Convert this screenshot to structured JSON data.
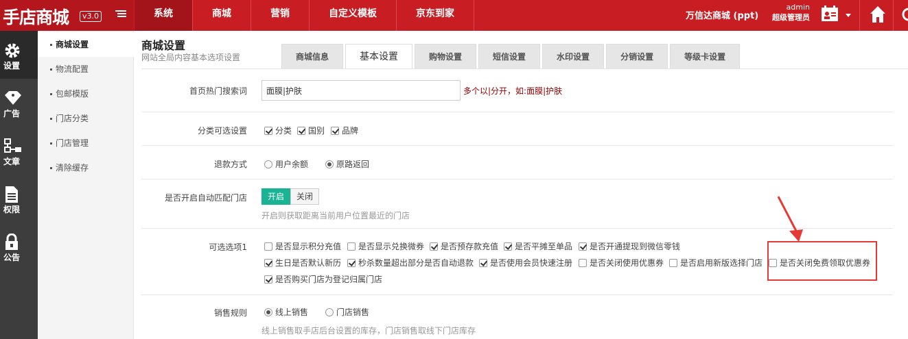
{
  "topbar": {
    "logo": "手店商城",
    "version": "v3.0",
    "nav": [
      "系统",
      "商城",
      "营销",
      "自定义模板",
      "京东到家"
    ],
    "shop_name": "万信达商城 (ppt)",
    "user": "admin",
    "role": "超级管理员"
  },
  "iconbar": {
    "items": [
      {
        "label": "设置",
        "icon": "gear-icon"
      },
      {
        "label": "广告",
        "icon": "tag-icon"
      },
      {
        "label": "文章",
        "icon": "sitemap-icon"
      },
      {
        "label": "权限",
        "icon": "document-icon"
      },
      {
        "label": "公告",
        "icon": "lock-icon"
      }
    ]
  },
  "subbar": {
    "items": [
      "商城设置",
      "物流配置",
      "包邮模版",
      "门店分类",
      "门店管理",
      "清除缓存"
    ]
  },
  "page": {
    "title": "商城设置",
    "subtitle": "网站全局内容基本选项设置",
    "tabs": [
      "商城信息",
      "基本设置",
      "购物设置",
      "短信设置",
      "水印设置",
      "分销设置",
      "等级卡设置"
    ]
  },
  "form": {
    "hot_search": {
      "label": "首页热门搜索词",
      "value": "面膜|护肤",
      "hint": "多个以|分开，如:面膜|护肤"
    },
    "category_filter": {
      "label": "分类可选设置",
      "options": [
        "分类",
        "国别",
        "品牌"
      ]
    },
    "refund": {
      "label": "退款方式",
      "options": [
        "用户余额",
        "原路返回"
      ]
    },
    "auto_store": {
      "label": "是否开启自动匹配门店",
      "on": "开启",
      "off": "关闭",
      "hint": "开启则获取距离当前用户位置最近的门店"
    },
    "options1": {
      "label": "可选选项1",
      "items": [
        "是否显示积分充值",
        "是否显示兑换微券",
        "是否预存款充值",
        "是否平摊至单品",
        "是否开通提现到微信零钱",
        "生日是否默认新历",
        "秒杀数量超出部分是否自动退款",
        "是否使用会员快速注册",
        "是否关闭使用优惠券",
        "是否启用新版选择门店",
        "是否关闭免费领取优惠券",
        "是否购买门店为登记归属门店"
      ]
    },
    "sales_rule": {
      "label": "销售规则",
      "options": [
        "线上销售",
        "门店销售"
      ],
      "hint": "线上销售取手店后台设置的库存，门店销售取线下门店库存"
    }
  },
  "colors": {
    "topbar": "#c81d23",
    "accent_green": "#1ab394",
    "highlight": "#e53935"
  }
}
